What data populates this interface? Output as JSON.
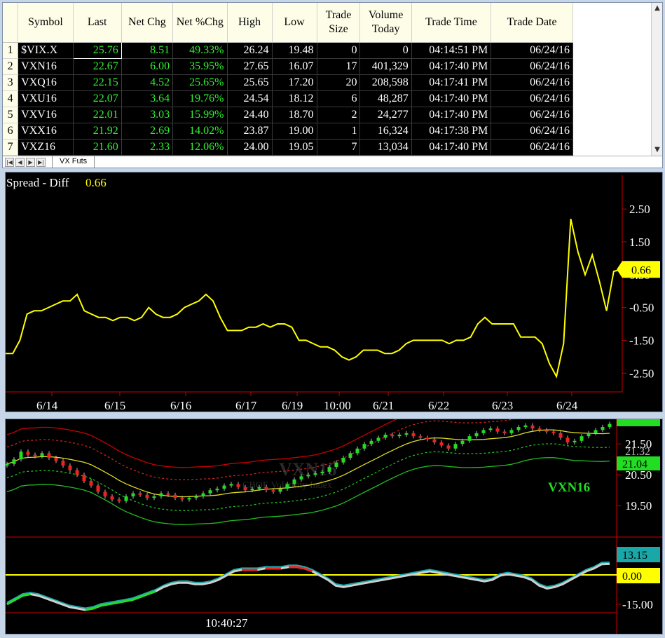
{
  "quote_grid": {
    "columns": [
      {
        "key": "symbol",
        "label": "Symbol"
      },
      {
        "key": "last",
        "label": "Last"
      },
      {
        "key": "net_chg",
        "label": "Net Chg"
      },
      {
        "key": "net_pct",
        "label": "Net %Chg"
      },
      {
        "key": "high",
        "label": "High"
      },
      {
        "key": "low",
        "label": "Low"
      },
      {
        "key": "trade_size",
        "label": "Trade Size"
      },
      {
        "key": "volume",
        "label": "Volume Today"
      },
      {
        "key": "trade_time",
        "label": "Trade Time"
      },
      {
        "key": "trade_date",
        "label": "Trade Date"
      }
    ],
    "rows": [
      {
        "n": "1",
        "symbol": "$VIX.X",
        "last": "25.76",
        "net_chg": "8.51",
        "net_pct": "49.33%",
        "high": "26.24",
        "low": "19.48",
        "trade_size": "0",
        "volume": "0",
        "trade_time": "04:14:51 PM",
        "trade_date": "06/24/16"
      },
      {
        "n": "2",
        "symbol": "VXN16",
        "last": "22.67",
        "net_chg": "6.00",
        "net_pct": "35.95%",
        "high": "27.65",
        "low": "16.07",
        "trade_size": "17",
        "volume": "401,329",
        "trade_time": "04:17:40 PM",
        "trade_date": "06/24/16"
      },
      {
        "n": "3",
        "symbol": "VXQ16",
        "last": "22.15",
        "net_chg": "4.52",
        "net_pct": "25.65%",
        "high": "25.65",
        "low": "17.20",
        "trade_size": "20",
        "volume": "208,598",
        "trade_time": "04:17:41 PM",
        "trade_date": "06/24/16"
      },
      {
        "n": "4",
        "symbol": "VXU16",
        "last": "22.07",
        "net_chg": "3.64",
        "net_pct": "19.76%",
        "high": "24.54",
        "low": "18.12",
        "trade_size": "6",
        "volume": "48,287",
        "trade_time": "04:17:40 PM",
        "trade_date": "06/24/16"
      },
      {
        "n": "5",
        "symbol": "VXV16",
        "last": "22.01",
        "net_chg": "3.03",
        "net_pct": "15.99%",
        "high": "24.40",
        "low": "18.70",
        "trade_size": "2",
        "volume": "24,277",
        "trade_time": "04:17:40 PM",
        "trade_date": "06/24/16"
      },
      {
        "n": "6",
        "symbol": "VXX16",
        "last": "21.92",
        "net_chg": "2.69",
        "net_pct": "14.02%",
        "high": "23.87",
        "low": "19.00",
        "trade_size": "1",
        "volume": "16,324",
        "trade_time": "04:17:38 PM",
        "trade_date": "06/24/16"
      },
      {
        "n": "7",
        "symbol": "VXZ16",
        "last": "21.60",
        "net_chg": "2.33",
        "net_pct": "12.06%",
        "high": "24.00",
        "low": "19.05",
        "trade_size": "7",
        "volume": "13,034",
        "trade_time": "04:17:40 PM",
        "trade_date": "06/24/16"
      }
    ],
    "sheet_tab": "VX Futs"
  },
  "colors": {
    "positive": "#32f032",
    "spread_line": "#ffff00",
    "axis_red": "#cc0000",
    "candle_up": "#22dd22",
    "candle_down": "#ee2222"
  },
  "chart_data": [
    {
      "type": "line",
      "title": "Spread - Diff",
      "last_value": "0.66",
      "x_labels": [
        "6/14",
        "6/15",
        "6/16",
        "6/17",
        "6/19",
        "10:00",
        "6/21",
        "6/22",
        "6/23",
        "6/24"
      ],
      "y_ticks": [
        "2.50",
        "1.50",
        "0.50",
        "-0.50",
        "-1.50",
        "-2.50"
      ],
      "ylim": [
        -2.9,
        3.4
      ],
      "series": [
        {
          "values": [
            -1.9,
            -1.9,
            -1.5,
            -0.7,
            -0.6,
            -0.6,
            -0.5,
            -0.4,
            -0.3,
            -0.3,
            -0.1,
            -0.6,
            -0.7,
            -0.8,
            -0.8,
            -0.9,
            -0.8,
            -0.8,
            -0.9,
            -0.8,
            -0.5,
            -0.7,
            -0.8,
            -0.8,
            -0.7,
            -0.5,
            -0.4,
            -0.3,
            -0.1,
            -0.3,
            -0.8,
            -1.2,
            -1.2,
            -1.2,
            -1.1,
            -1.1,
            -1.0,
            -1.1,
            -1.0,
            -1.0,
            -1.1,
            -1.5,
            -1.5,
            -1.6,
            -1.7,
            -1.7,
            -1.8,
            -2.0,
            -2.1,
            -2.0,
            -1.8,
            -1.8,
            -1.8,
            -1.9,
            -1.9,
            -1.8,
            -1.6,
            -1.5,
            -1.5,
            -1.5,
            -1.5,
            -1.5,
            -1.6,
            -1.5,
            -1.5,
            -1.4,
            -1.0,
            -0.8,
            -1.0,
            -1.0,
            -1.0,
            -1.0,
            -1.4,
            -1.4,
            -1.4,
            -1.6,
            -2.2,
            -2.6,
            -1.6,
            2.2,
            1.2,
            0.5,
            1.1,
            0.3,
            -0.6,
            0.6,
            0.66
          ]
        }
      ]
    },
    {
      "type": "candlestick",
      "title": "VXN16",
      "watermark": "VXN16",
      "watermark_sub": "CBOE Volatility Index",
      "y_ticks": [
        "21.50",
        "20.50",
        "19.50"
      ],
      "price_tags": [
        "21.32",
        "21.04"
      ],
      "ylim": [
        18.55,
        22.3
      ],
      "closes": [
        20.85,
        21.0,
        21.25,
        21.15,
        21.1,
        21.2,
        21.05,
        20.95,
        20.8,
        20.65,
        20.5,
        20.3,
        20.15,
        19.95,
        19.8,
        19.7,
        19.65,
        19.8,
        19.9,
        19.85,
        19.75,
        19.8,
        19.9,
        19.85,
        19.75,
        19.7,
        19.75,
        19.8,
        19.9,
        20.0,
        20.05,
        20.15,
        20.2,
        20.1,
        20.0,
        20.05,
        20.1,
        20.0,
        19.95,
        20.05,
        20.2,
        20.35,
        20.45,
        20.5,
        20.55,
        20.6,
        20.75,
        20.9,
        21.05,
        21.2,
        21.35,
        21.5,
        21.6,
        21.7,
        21.8,
        21.75,
        21.8,
        21.85,
        21.75,
        21.7,
        21.65,
        21.55,
        21.45,
        21.35,
        21.5,
        21.6,
        21.75,
        21.85,
        21.95,
        22.0,
        21.9,
        21.85,
        21.95,
        22.05,
        22.1,
        22.0,
        21.95,
        21.9,
        21.85,
        21.7,
        21.55,
        21.6,
        21.75,
        21.85,
        21.95,
        22.05,
        22.15
      ],
      "oscillator": {
        "y_ticks": [
          "0.00",
          "-15.00"
        ],
        "price_tag": "13.15",
        "zero_tag": "0.00",
        "time_label": "10:40:27",
        "ylim": [
          -20,
          30
        ],
        "values": [
          -15,
          -12,
          -9,
          -8,
          -9,
          -11,
          -13,
          -15,
          -17,
          -18,
          -19,
          -18,
          -16,
          -15,
          -14,
          -13,
          -12,
          -10,
          -8,
          -6,
          -3,
          -1,
          0,
          0,
          -1,
          -1,
          0,
          2,
          5,
          8,
          9,
          9,
          9,
          10,
          10,
          10,
          11,
          11,
          10,
          8,
          5,
          2,
          -2,
          -3,
          -2,
          -1,
          0,
          1,
          2,
          3,
          4,
          5,
          6,
          7,
          8,
          7,
          6,
          5,
          4,
          3,
          2,
          1,
          2,
          5,
          6,
          5,
          4,
          2,
          -2,
          -4,
          -3,
          -1,
          2,
          5,
          8,
          10,
          13,
          13.15
        ]
      }
    }
  ]
}
